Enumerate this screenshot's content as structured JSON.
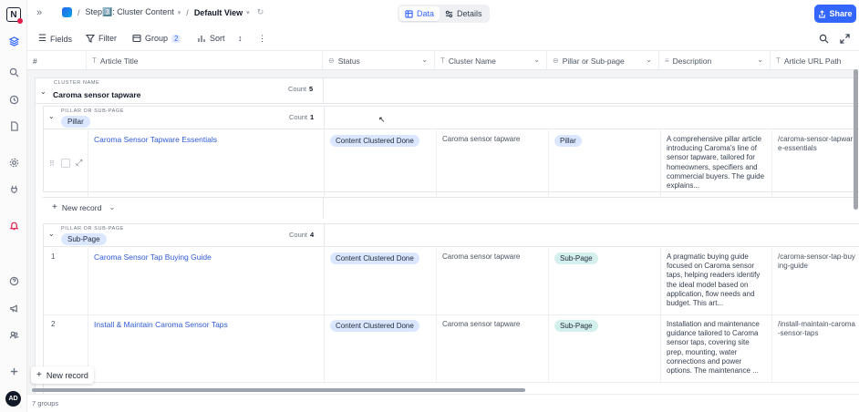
{
  "app": {
    "logo_letter": "N",
    "breadcrumb": {
      "base": "Step3️⃣: Cluster Content",
      "view": "Default View"
    },
    "view_toggle": {
      "data_label": "Data",
      "details_label": "Details"
    },
    "share_label": "Share",
    "user_initials": "AD",
    "colors": {
      "accent": "#3366ff",
      "link": "#2f5bd8",
      "status_chip": "#dbe7ff",
      "subpage_chip": "#d4f0ee",
      "notification": "#e11d48"
    }
  },
  "toolbar": {
    "fields_label": "Fields",
    "filter_label": "Filter",
    "group_label": "Group",
    "group_count": "2",
    "sort_label": "Sort"
  },
  "columns": {
    "index": "#",
    "title": "Article Title",
    "status": "Status",
    "cluster": "Cluster Name",
    "pillar": "Pillar or Sub-page",
    "description": "Description",
    "url": "Article URL Path"
  },
  "group_cluster": {
    "caption": "CLUSTER NAME",
    "name": "Caroma sensor tapware",
    "count_label": "Count",
    "count": "5"
  },
  "group_pillar": {
    "caption": "PILLAR OR SUB-PAGE",
    "name": "Pillar",
    "count_label": "Count",
    "count": "1",
    "new_record_label": "New record",
    "rows": [
      {
        "index": "",
        "title": "Caroma Sensor Tapware Essentials",
        "status": "Content Clustered Done",
        "cluster": "Caroma sensor tapware",
        "pillar": "Pillar",
        "description": "A comprehensive pillar article introducing Caroma's line of sensor tapware, tailored for homeowners, specifiers and commercial buyers. The guide explains...",
        "url": "/caroma-sensor-tapware-essentials"
      }
    ]
  },
  "group_sub": {
    "caption": "PILLAR OR SUB-PAGE",
    "name": "Sub-Page",
    "count_label": "Count",
    "count": "4",
    "rows": [
      {
        "index": "1",
        "title": "Caroma Sensor Tap Buying Guide",
        "status": "Content Clustered Done",
        "cluster": "Caroma sensor tapware",
        "pillar": "Sub-Page",
        "description": "A pragmatic buying guide focused on Caroma sensor taps, helping readers identify the ideal model based on application, flow needs and budget. This art...",
        "url": "/caroma-sensor-tap-buying-guide"
      },
      {
        "index": "2",
        "title": "Install & Maintain Caroma Sensor Taps",
        "status": "Content Clustered Done",
        "cluster": "Caroma sensor tapware",
        "pillar": "Sub-Page",
        "description": "Installation and maintenance guidance tailored to Caroma sensor taps, covering site prep, mounting, water connections and power options. The maintenance ...",
        "url": "/install-maintain-caroma-sensor-taps"
      }
    ]
  },
  "footer": {
    "new_record_label": "New record",
    "groups_label": "7 groups"
  }
}
